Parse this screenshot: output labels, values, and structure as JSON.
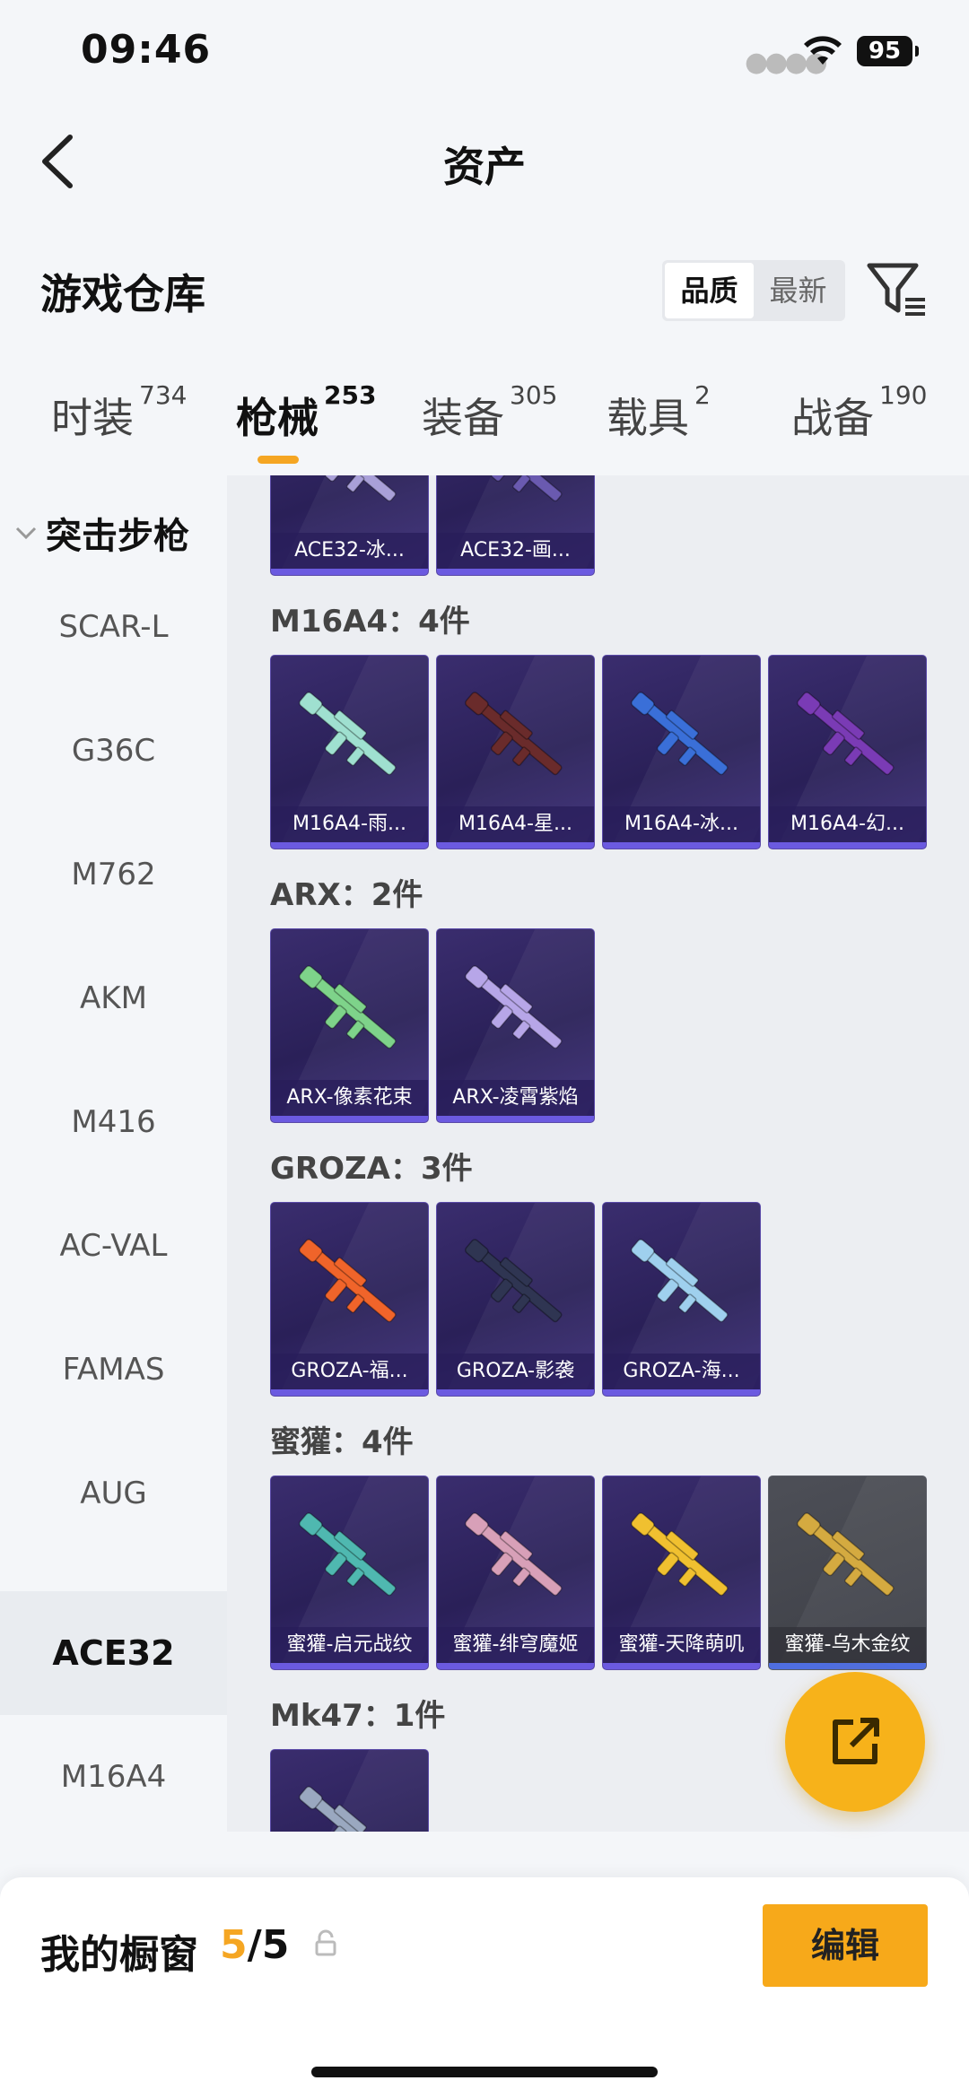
{
  "status": {
    "time": "09:46",
    "battery": "95"
  },
  "header": {
    "title": "资产"
  },
  "warehouse": {
    "title": "游戏仓库",
    "sort_options": [
      "品质",
      "最新"
    ]
  },
  "tabs": [
    {
      "label": "时装",
      "count": "734"
    },
    {
      "label": "枪械",
      "count": "253"
    },
    {
      "label": "装备",
      "count": "305"
    },
    {
      "label": "载具",
      "count": "2"
    },
    {
      "label": "战备",
      "count": "190"
    }
  ],
  "sidebar": {
    "category": "突击步枪",
    "items": [
      "SCAR-L",
      "G36C",
      "M762",
      "AKM",
      "M416",
      "AC-VAL",
      "FAMAS",
      "AUG",
      "ACE32",
      "M16A4"
    ],
    "active": "ACE32"
  },
  "groups": [
    {
      "label": "",
      "cards": [
        "ACE32-冰...",
        "ACE32-画..."
      ]
    },
    {
      "label": "M16A4：4件",
      "cards": [
        "M16A4-雨...",
        "M16A4-星...",
        "M16A4-冰...",
        "M16A4-幻..."
      ]
    },
    {
      "label": "ARX：2件",
      "cards": [
        "ARX-像素花束",
        "ARX-凌霄紫焰"
      ]
    },
    {
      "label": "GROZA：3件",
      "cards": [
        "GROZA-福...",
        "GROZA-影袭",
        "GROZA-海..."
      ]
    },
    {
      "label": "蜜獾：4件",
      "cards": [
        "蜜獾-启元战纹",
        "蜜獾-绯穹魔姬",
        "蜜獾-天降萌叽",
        "蜜獾-乌木金纹"
      ]
    },
    {
      "label": "Mk47：1件",
      "cards": [
        ""
      ]
    }
  ],
  "gun_colors": {
    "ace32": [
      "#a9a0d8",
      "#6a5ab0"
    ],
    "m16": [
      "#9fe0d0",
      "#6a2b2b",
      "#3a6fd8",
      "#7a3bb5"
    ],
    "arx": [
      "#7ed38a",
      "#b7a6e8"
    ],
    "groza": [
      "#f0642a",
      "#2f3552",
      "#9fd0ee"
    ],
    "badger": [
      "#4fb8b0",
      "#d8a0b8",
      "#f0c030",
      "#d4aa40"
    ],
    "mk47": [
      "#9aa8c0"
    ]
  },
  "bottom": {
    "showcase_label": "我的橱窗",
    "current": "5",
    "total": "/5",
    "edit_label": "编辑"
  }
}
